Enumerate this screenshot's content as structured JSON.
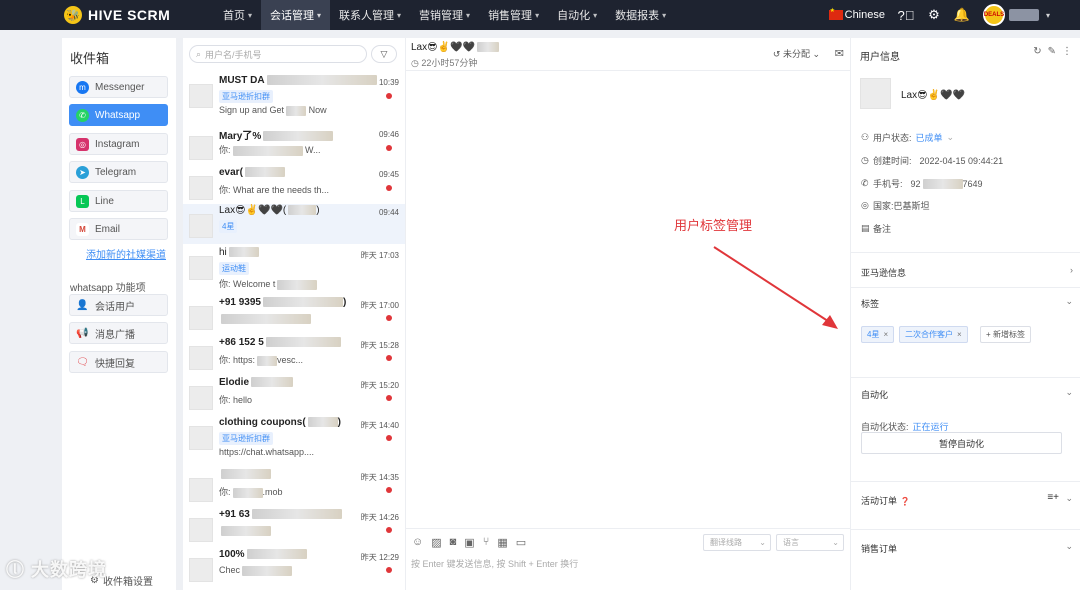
{
  "topbar": {
    "logo": "HIVE SCRM",
    "nav": [
      {
        "label": "首页",
        "caret": true
      },
      {
        "label": "会话管理",
        "caret": true
      },
      {
        "label": "联系人管理",
        "caret": true
      },
      {
        "label": "营销管理",
        "caret": true
      },
      {
        "label": "销售管理",
        "caret": true
      },
      {
        "label": "自动化",
        "caret": true
      },
      {
        "label": "数据报表",
        "caret": true
      }
    ],
    "language": "Chinese",
    "avatar_text": "DEALS"
  },
  "inbox": {
    "title": "收件箱",
    "channels": [
      {
        "label": "Messenger",
        "color": "#1877f2",
        "glyph": "m"
      },
      {
        "label": "Whatsapp",
        "color": "#25d366",
        "glyph": "w"
      },
      {
        "label": "Instagram",
        "color": "#d6336c",
        "glyph": "◎"
      },
      {
        "label": "Telegram",
        "color": "#2aa0d8",
        "glyph": "➤"
      },
      {
        "label": "Line",
        "color": "#06c755",
        "glyph": "L"
      },
      {
        "label": "Email",
        "color": "#d44638",
        "glyph": "M"
      }
    ],
    "add_channel": "添加新的社媒渠道",
    "whatsapp_functions_title": "whatsapp 功能项",
    "functions": [
      {
        "label": "会话用户",
        "icon": "user-icon"
      },
      {
        "label": "消息广播",
        "icon": "broadcast-icon"
      },
      {
        "label": "快捷回复",
        "icon": "quick-reply-icon"
      }
    ],
    "settings": "收件箱设置"
  },
  "conversations": {
    "search_placeholder": "用户名/手机号",
    "items": [
      {
        "name": "MUST DA",
        "tag": "亚马逊折扣群",
        "msg": "Sign up and Get",
        "msg2": "Now",
        "time": "10:39",
        "unread": true
      },
      {
        "name": "Mary了%",
        "tag": "",
        "msg": "你:",
        "msg2": "W...",
        "time": "09:46",
        "unread": true
      },
      {
        "name": "evar(",
        "tag": "",
        "msg": "你: What are the needs th...",
        "msg2": "",
        "time": "09:45",
        "unread": true
      },
      {
        "name": "Lax😎✌️🖤🖤(",
        "tag": "4星",
        "msg": "",
        "msg2": "",
        "time": "09:44",
        "unread": false
      },
      {
        "name": "hi",
        "tag": "运动鞋",
        "msg": "你: Welcome t",
        "msg2": "",
        "time": "昨天 17:03",
        "unread": false
      },
      {
        "name": "+91 9395",
        "tag": "",
        "msg": "",
        "msg2": "",
        "time": "昨天 17:00",
        "unread": true
      },
      {
        "name": "+86 152 5",
        "tag": "",
        "msg": "你: https:",
        "msg2": "vesc...",
        "time": "昨天 15:28",
        "unread": true
      },
      {
        "name": "Elodie",
        "tag": "",
        "msg": "你: hello",
        "msg2": "",
        "time": "昨天 15:20",
        "unread": true
      },
      {
        "name": "clothing coupons(",
        "tag": "亚马逊折扣群",
        "msg": "https://chat.whatsapp....",
        "msg2": "",
        "time": "昨天 14:40",
        "unread": true
      },
      {
        "name": "",
        "tag": "",
        "msg": "你:",
        "msg2": ".mob",
        "time": "昨天 14:35",
        "unread": true
      },
      {
        "name": "+91 63",
        "tag": "",
        "msg": "",
        "msg2": "",
        "time": "昨天 14:26",
        "unread": true
      },
      {
        "name": "100%",
        "tag": "",
        "msg": "Chec",
        "msg2": "",
        "time": "昨天 12:29",
        "unread": true
      }
    ]
  },
  "chat": {
    "title": "Lax😎✌️🖤🖤",
    "subtitle": "22小时57分钟",
    "assign": "未分配",
    "annotation": "用户标签管理",
    "translate_placeholder": "翻译线路",
    "language_placeholder": "语言",
    "input_hint": "按 Enter 键发送信息, 按 Shift + Enter 换行"
  },
  "user_info": {
    "title": "用户信息",
    "name": "Lax😎✌️🖤🖤",
    "status_label": "用户状态:",
    "status_value": "已成单",
    "created_label": "创建时间:",
    "created_value": "2022-04-15 09:44:21",
    "phone_label": "手机号:",
    "phone_prefix": "92",
    "phone_suffix": "7649",
    "country_label": "国家:",
    "country_value": "巴基斯坦",
    "note_label": "备注",
    "amazon_info": "亚马逊信息",
    "tags_title": "标签",
    "tags": [
      "4星",
      "二次合作客户"
    ],
    "add_tag": "+ 新增标签",
    "automation_title": "自动化",
    "automation_status_label": "自动化状态:",
    "automation_status_value": "正在运行",
    "pause_automation": "暂停自动化",
    "active_orders": "活动订单",
    "sales_orders": "销售订单"
  },
  "watermark": "大数跨境"
}
